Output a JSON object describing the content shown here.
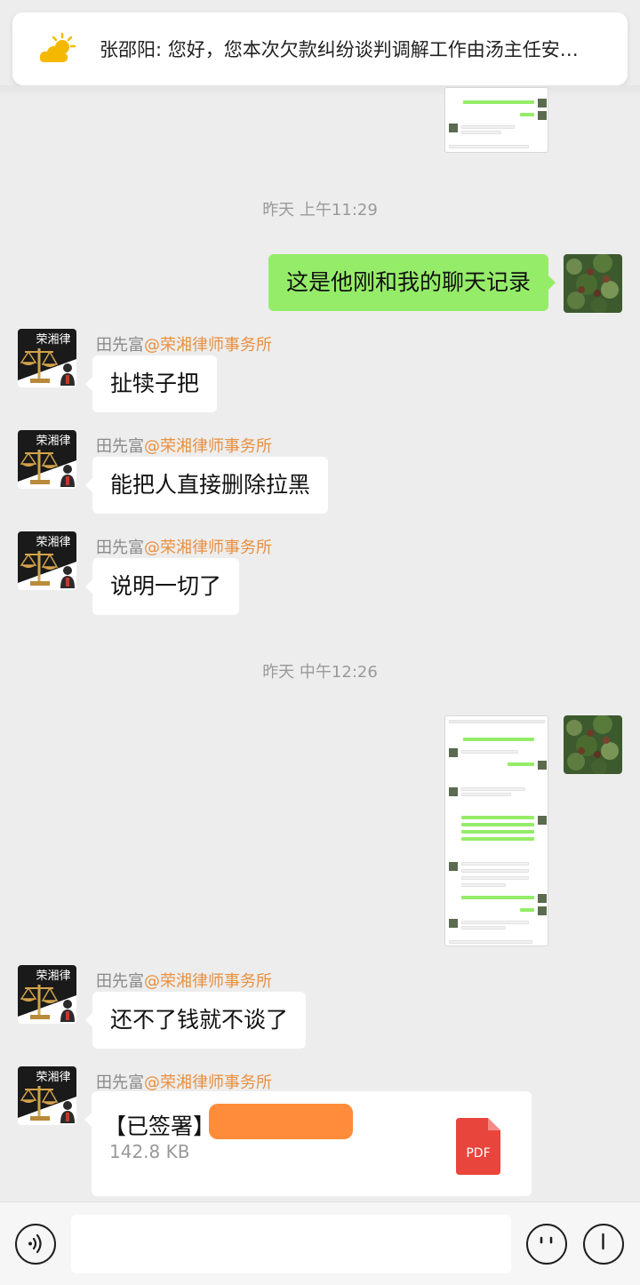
{
  "notice": {
    "icon": "sun-cloud-icon",
    "text": "张邵阳: 您好，您本次欠款纠纷谈判调解工作由汤主任安…"
  },
  "timestamps": [
    "昨天 上午11:29",
    "昨天 中午12:26"
  ],
  "sender": {
    "name": "田先富",
    "org": "@荣湘律师事务所"
  },
  "messages": {
    "m1": "这是他刚和我的聊天记录",
    "m2": "扯犊子把",
    "m3": "能把人直接删除拉黑",
    "m4": "说明一切了",
    "m5": "还不了钱就不谈了"
  },
  "file": {
    "title": "【已签署】",
    "size": "142.8 KB",
    "type": "PDF",
    "icon": "pdf-file-icon"
  },
  "colors": {
    "outgoing_bubble": "#95ec69",
    "incoming_bubble": "#ffffff",
    "background": "#ededed",
    "org_name": "#e89040",
    "pdf_red": "#e8453c"
  },
  "bottom_bar": {
    "left_icon": "voice-icon",
    "right_icons": [
      "emoji-icon",
      "plus-icon"
    ]
  }
}
